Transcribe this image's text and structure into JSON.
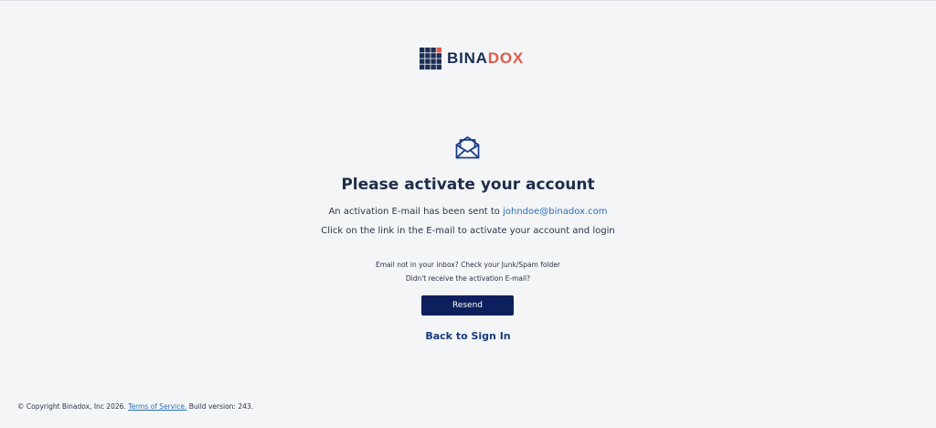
{
  "brand": {
    "name_part1": "BINA",
    "name_part2": "DOX",
    "primary_color": "#1b2e55",
    "accent_color": "#e35a4a",
    "logo_icon": "grid-logo-icon"
  },
  "main": {
    "icon": "envelope-open-icon",
    "heading": "Please activate your account",
    "sent_prefix": "An activation E-mail has been sent to ",
    "email": "johndoe@binadox.com",
    "click_text": "Click on the link in the E-mail to activate your account and login",
    "inbox_hint": "Email not in your inbox? Check your Junk/Spam folder",
    "didnt_receive": "Didn't receive the activation E-mail?",
    "resend_label": "Resend",
    "back_label": "Back to Sign In",
    "button_color": "#0d1f5c",
    "link_color": "#2e6fb8"
  },
  "footer": {
    "copyright": "© Copyright Binadox, Inc 2026.",
    "terms_label": "Terms of Service.",
    "build": "Build version: 243."
  }
}
